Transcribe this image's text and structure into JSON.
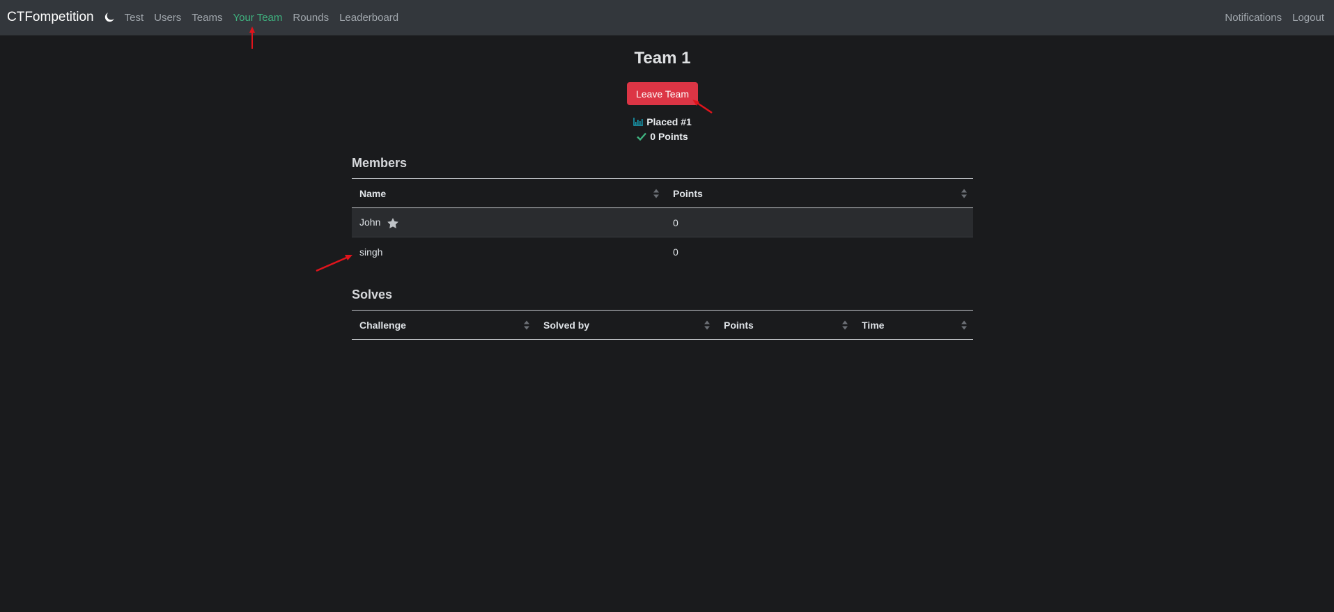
{
  "navbar": {
    "brand": "CTFompetition",
    "theme_icon": "moon-icon",
    "links": [
      "Test",
      "Users",
      "Teams",
      "Your Team",
      "Rounds",
      "Leaderboard"
    ],
    "active_link": "Your Team",
    "right_links": [
      "Notifications",
      "Logout"
    ]
  },
  "team": {
    "name": "Team 1",
    "leave_label": "Leave Team",
    "placed": "Placed #1",
    "points": "0 Points"
  },
  "members": {
    "title": "Members",
    "columns": [
      "Name",
      "Points"
    ],
    "rows": [
      {
        "name": "John",
        "points": "0",
        "captain_icon": "star-icon"
      },
      {
        "name": "singh",
        "points": "0"
      }
    ]
  },
  "solves": {
    "title": "Solves",
    "columns": [
      "Challenge",
      "Solved by",
      "Points",
      "Time"
    ],
    "rows": []
  },
  "colors": {
    "navbar_bg": "#33373c",
    "page_bg": "#1a1b1d",
    "accent": "#3fb27f",
    "danger": "#dc3545",
    "annotation": "#e0141c"
  }
}
